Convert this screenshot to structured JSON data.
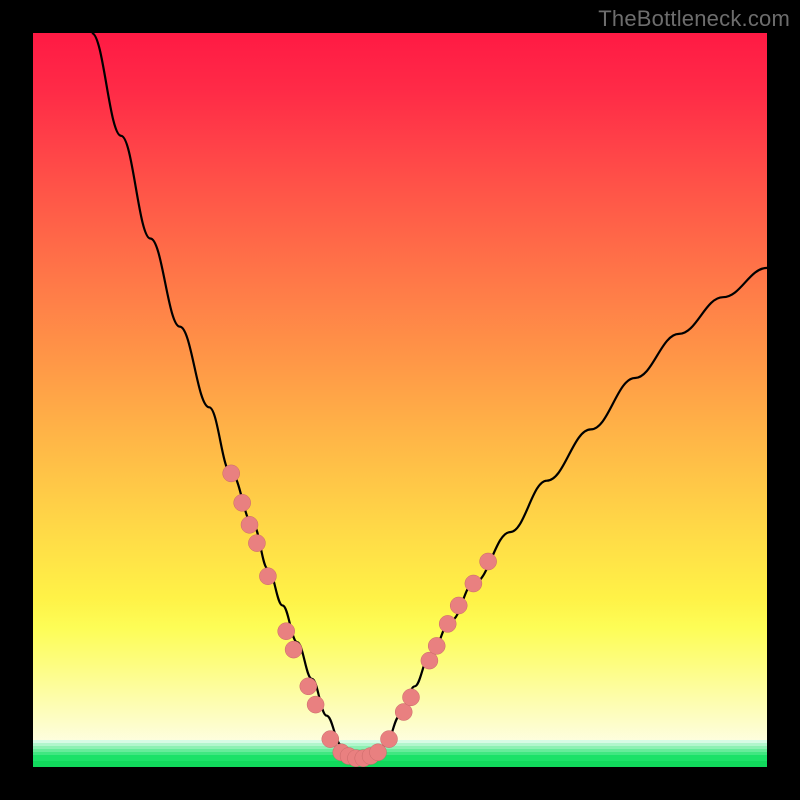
{
  "watermark": "TheBottleneck.com",
  "colors": {
    "gradient_stops": [
      {
        "pct": 0,
        "hex": "#ff1a44"
      },
      {
        "pct": 8,
        "hex": "#ff2b47"
      },
      {
        "pct": 20,
        "hex": "#ff5048"
      },
      {
        "pct": 32,
        "hex": "#ff7348"
      },
      {
        "pct": 44,
        "hex": "#ff9547"
      },
      {
        "pct": 56,
        "hex": "#ffb847"
      },
      {
        "pct": 68,
        "hex": "#ffda47"
      },
      {
        "pct": 77,
        "hex": "#fff247"
      },
      {
        "pct": 81,
        "hex": "#fdfd56"
      },
      {
        "pct": 86,
        "hex": "#fdfd80"
      },
      {
        "pct": 93,
        "hex": "#fdfdc0"
      },
      {
        "pct": 100,
        "hex": "#fefefe"
      }
    ],
    "bottom_bands": [
      {
        "hex": "#d7fbe5",
        "h": 3
      },
      {
        "hex": "#b1f6cc",
        "h": 3
      },
      {
        "hex": "#8cf1b3",
        "h": 3
      },
      {
        "hex": "#66ec9a",
        "h": 3
      },
      {
        "hex": "#40e781",
        "h": 3
      },
      {
        "hex": "#1be268",
        "h": 6
      },
      {
        "hex": "#11d95c",
        "h": 6
      }
    ],
    "curve": "#000000",
    "marker_fill": "#e98080",
    "marker_stroke": "#c96868",
    "frame": "#000000"
  },
  "chart_data": {
    "type": "line",
    "title": "",
    "xlabel": "",
    "ylabel": "",
    "xlim": [
      0,
      100
    ],
    "ylim": [
      0,
      100
    ],
    "note": "Axes are unlabeled; values are read as percent of plot width/height. Curve is a V-shaped bottleneck curve dipping to ~0 around x≈40–46 then rising again. Salmon markers cluster on both flanks of the valley and along the floor.",
    "series": [
      {
        "name": "bottleneck-curve",
        "x": [
          8,
          12,
          16,
          20,
          24,
          27,
          30,
          32,
          34,
          36,
          38,
          40,
          42,
          44,
          46,
          48,
          50,
          52,
          54,
          57,
          60,
          65,
          70,
          76,
          82,
          88,
          94,
          100
        ],
        "y": [
          100,
          86,
          72,
          60,
          49,
          40,
          33,
          27,
          22,
          17,
          12,
          7,
          3,
          1,
          1,
          3,
          7,
          11,
          15,
          20,
          25,
          32,
          39,
          46,
          53,
          59,
          64,
          68
        ]
      }
    ],
    "markers": [
      {
        "x": 27.0,
        "y": 40.0
      },
      {
        "x": 28.5,
        "y": 36.0
      },
      {
        "x": 29.5,
        "y": 33.0
      },
      {
        "x": 30.5,
        "y": 30.5
      },
      {
        "x": 32.0,
        "y": 26.0
      },
      {
        "x": 34.5,
        "y": 18.5
      },
      {
        "x": 35.5,
        "y": 16.0
      },
      {
        "x": 37.5,
        "y": 11.0
      },
      {
        "x": 38.5,
        "y": 8.5
      },
      {
        "x": 40.5,
        "y": 3.8
      },
      {
        "x": 42.0,
        "y": 2.0
      },
      {
        "x": 43.0,
        "y": 1.5
      },
      {
        "x": 44.0,
        "y": 1.2
      },
      {
        "x": 45.0,
        "y": 1.2
      },
      {
        "x": 46.0,
        "y": 1.5
      },
      {
        "x": 47.0,
        "y": 2.0
      },
      {
        "x": 48.5,
        "y": 3.8
      },
      {
        "x": 50.5,
        "y": 7.5
      },
      {
        "x": 51.5,
        "y": 9.5
      },
      {
        "x": 54.0,
        "y": 14.5
      },
      {
        "x": 55.0,
        "y": 16.5
      },
      {
        "x": 56.5,
        "y": 19.5
      },
      {
        "x": 58.0,
        "y": 22.0
      },
      {
        "x": 60.0,
        "y": 25.0
      },
      {
        "x": 62.0,
        "y": 28.0
      }
    ]
  }
}
